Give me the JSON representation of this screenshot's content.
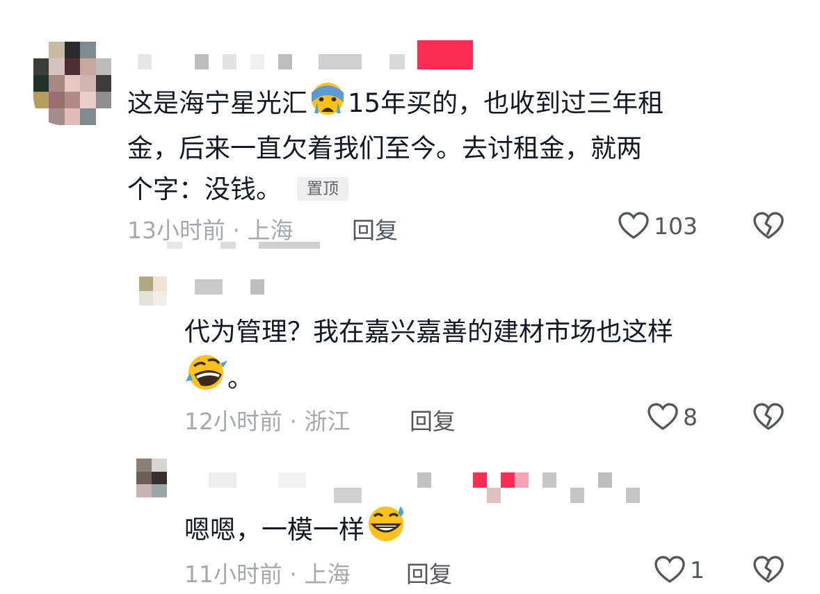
{
  "colors": {
    "text": "#161823",
    "meta": "#a7a8ad",
    "action": "#55565b",
    "badge_bg": "#efefef",
    "name_pink": "#fe2c55"
  },
  "comments": [
    {
      "text": "这是海宁星光汇",
      "emoji": "crying-face",
      "text_after_emoji_line1": "15年买的，也收到过三年租",
      "text_line2": "金，后来一直欠着我们至今。去讨租金，就两",
      "text_line3": "个字：没钱。",
      "badge": "置顶",
      "time_location": "13小时前 · 上海",
      "reply": "回复",
      "likes": "103"
    },
    {
      "text_line1": "代为管理？我在嘉兴嘉善的建材市场也这样",
      "emoji": "rolling-laughing-face",
      "text_after_emoji": "。",
      "time_location": "12小时前 · 浙江",
      "reply": "回复",
      "likes": "8"
    },
    {
      "text": "嗯嗯，一模一样",
      "emoji": "grinning-sweat-face",
      "time_location": "11小时前 · 上海",
      "reply": "回复",
      "likes": "1"
    }
  ]
}
